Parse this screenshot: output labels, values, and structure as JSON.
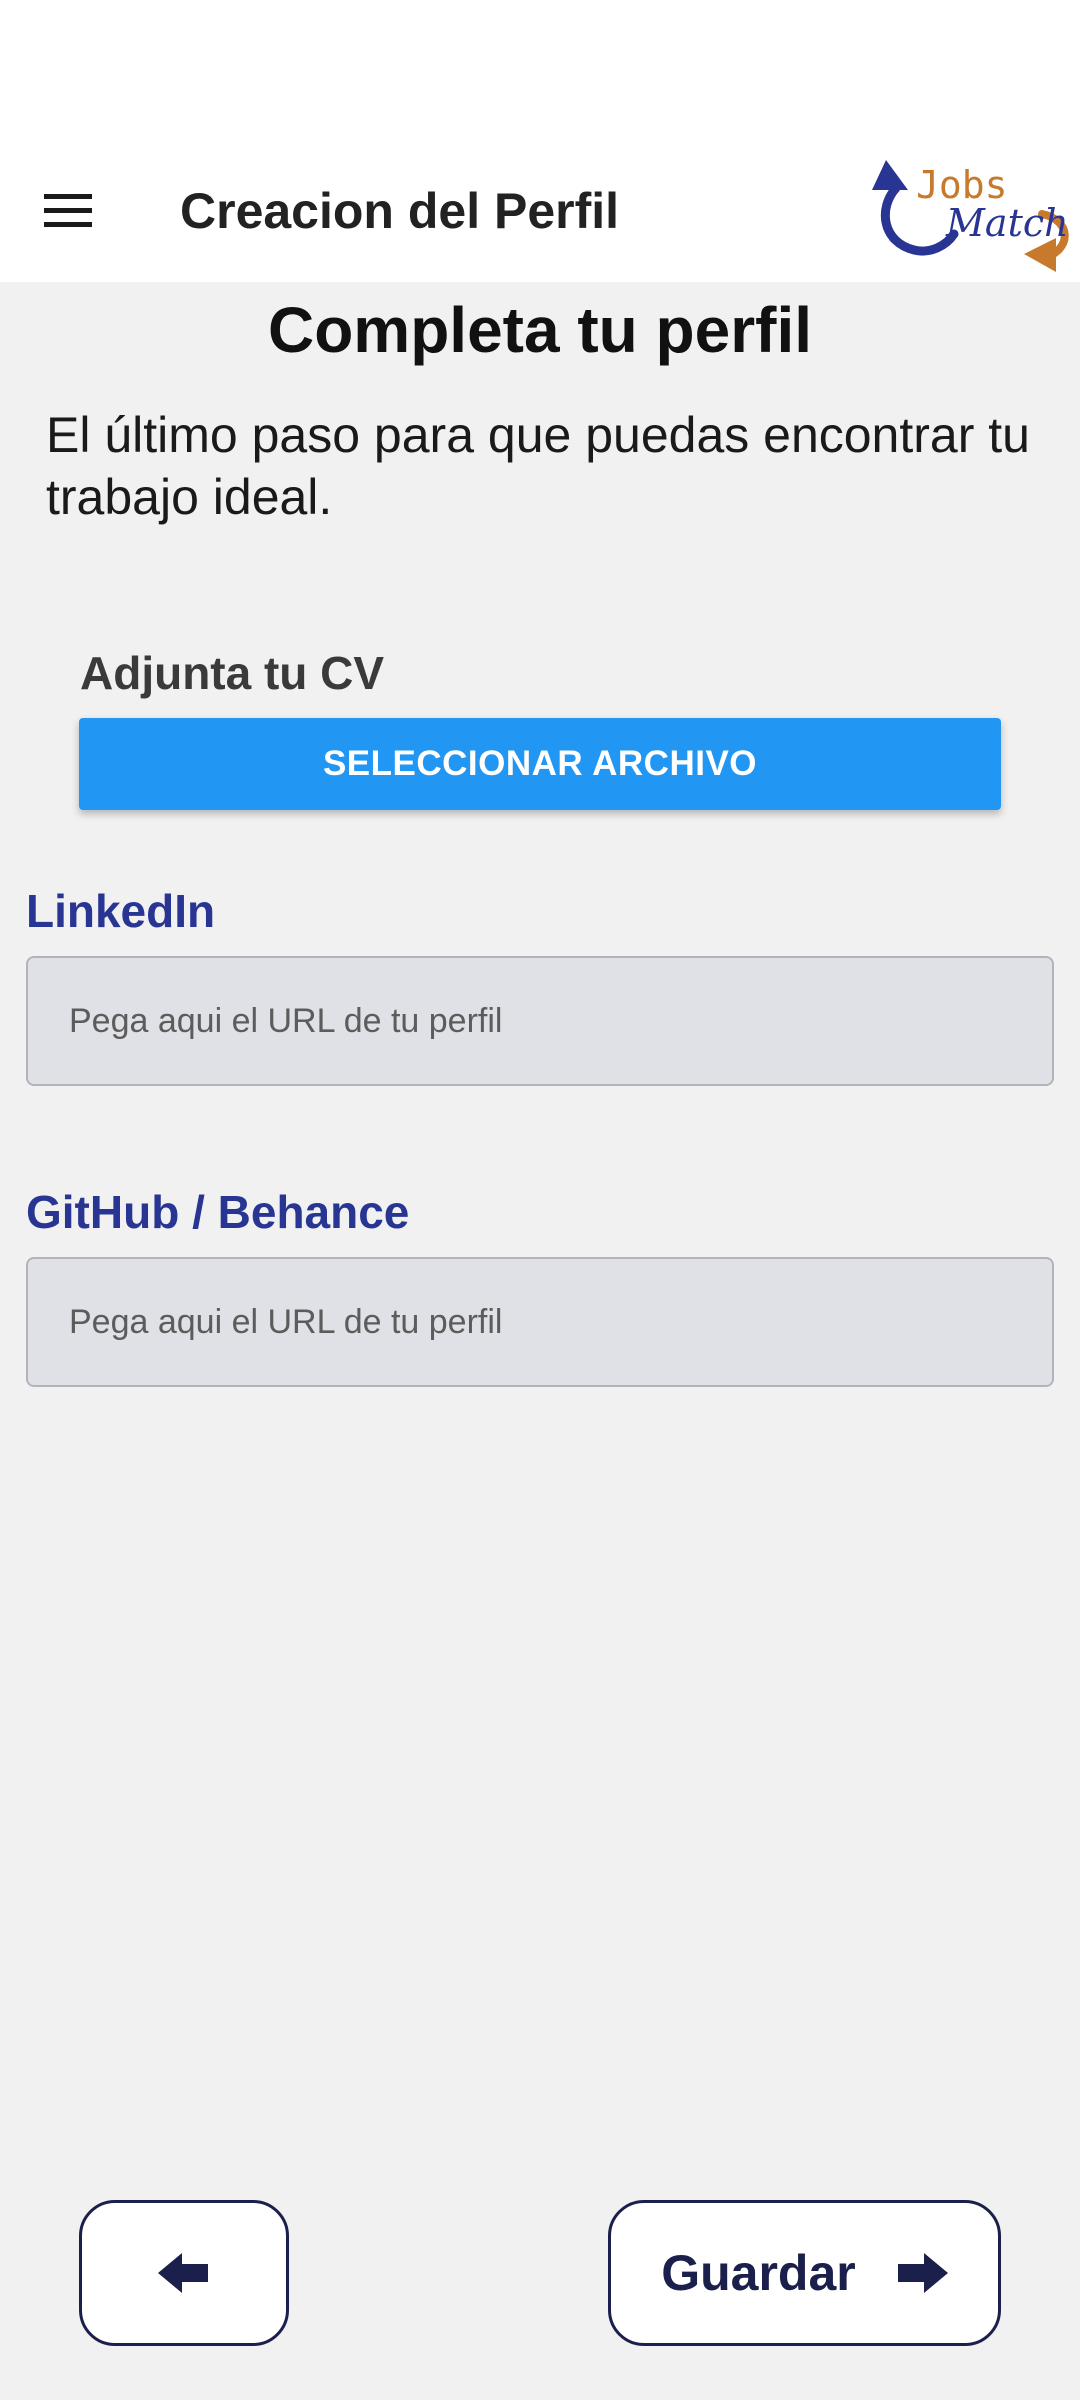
{
  "app_bar": {
    "title": "Creacion del Perfil",
    "menu_icon": "hamburger-menu-icon",
    "logo": {
      "text_top": "Jobs",
      "text_bottom": "Match",
      "color_primary": "#283593",
      "color_accent": "#c77a2c"
    }
  },
  "main": {
    "title": "Completa tu perfil",
    "subtitle": "El último paso para que puedas encontrar tu trabajo ideal."
  },
  "cv": {
    "label": "Adjunta tu CV",
    "button_label": "SELECCIONAR ARCHIVO"
  },
  "linkedin": {
    "label": "LinkedIn",
    "placeholder": "Pega aqui el URL de tu perfil",
    "value": ""
  },
  "github": {
    "label": "GitHub / Behance",
    "placeholder": "Pega aqui el URL de tu perfil",
    "value": ""
  },
  "footer": {
    "back_icon": "arrow-left-icon",
    "save_label": "Guardar",
    "save_icon": "arrow-right-icon"
  },
  "colors": {
    "primary_button": "#2196f3",
    "label_blue": "#283593",
    "nav_dark": "#1b1f4b",
    "background": "#f1f1f1"
  }
}
